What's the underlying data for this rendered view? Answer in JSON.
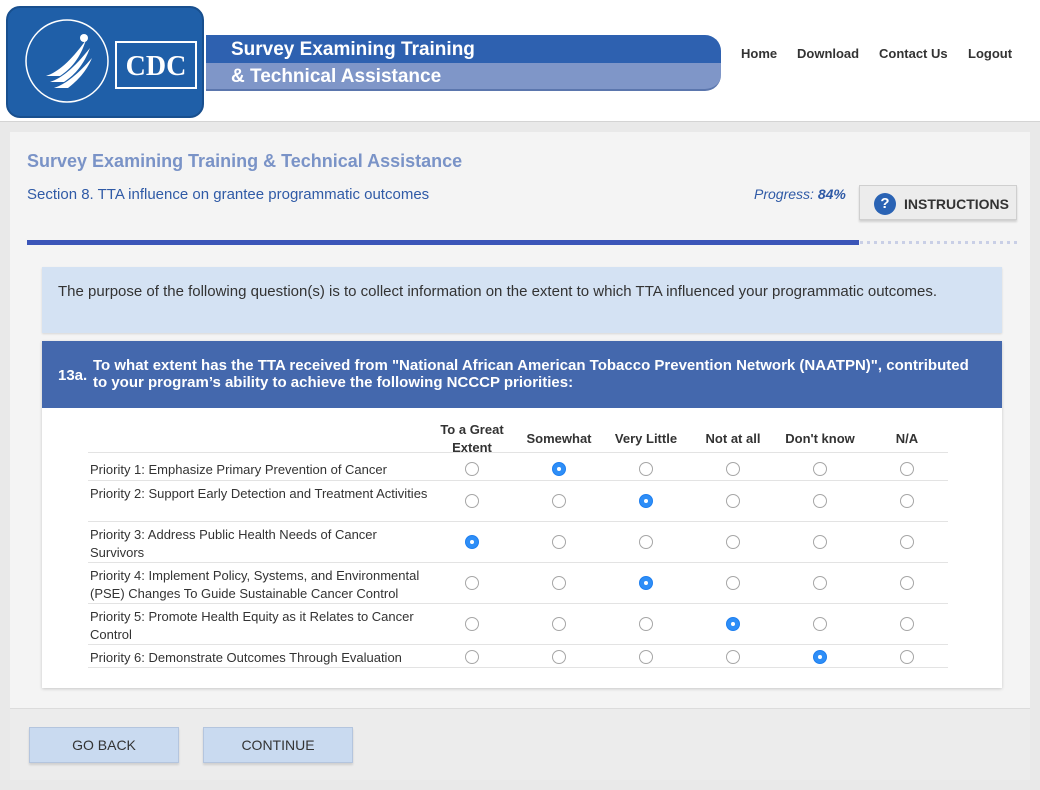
{
  "header": {
    "agency_mark": "CDC",
    "seal_text": "DEPARTMENT OF HEALTH & HUMAN SERVICES USA",
    "banner_line1": "Survey Examining Training",
    "banner_line2": "& Technical Assistance",
    "nav": [
      "Home",
      "Download",
      "Contact Us",
      "Logout"
    ],
    "colors": {
      "brand_blue": "#1f5fa8",
      "banner_dark": "#2e61b0",
      "banner_light": "#7f96c8"
    }
  },
  "page": {
    "survey_title": "Survey Examining Training & Technical Assistance",
    "section_title": "Section 8. TTA influence on grantee programmatic outcomes",
    "progress_label": "Progress:",
    "progress_value": "84%",
    "progress_fraction": 0.84,
    "instructions_label": "INSTRUCTIONS",
    "instructions_icon": "question-circle-icon"
  },
  "purpose": "The purpose of the following question(s) is to collect information on the extent to which TTA influenced your programmatic outcomes.",
  "question": {
    "number": "13a.",
    "text": "To what extent has the TTA received from \"National African American Tobacco Prevention Network (NAATPN)\", contributed to your program’s ability to achieve the following NCCCP priorities:",
    "columns": [
      "To a Great Extent",
      "Somewhat",
      "Very Little",
      "Not at all",
      "Don't know",
      "N/A"
    ],
    "rows": [
      {
        "label": "Priority 1: Emphasize Primary Prevention of Cancer",
        "selected": 1
      },
      {
        "label": "Priority 2: Support Early Detection and Treatment Activities",
        "selected": 2
      },
      {
        "label": "Priority 3: Address Public Health Needs of Cancer Survivors",
        "selected": 0
      },
      {
        "label": "Priority 4: Implement Policy, Systems, and Environmental (PSE) Changes To Guide Sustainable Cancer Control",
        "selected": 2
      },
      {
        "label": "Priority 5: Promote Health Equity as it Relates to Cancer Control",
        "selected": 3
      },
      {
        "label": "Priority 6: Demonstrate Outcomes Through Evaluation",
        "selected": 4
      }
    ]
  },
  "footer": {
    "back_label": "GO BACK",
    "continue_label": "CONTINUE"
  }
}
